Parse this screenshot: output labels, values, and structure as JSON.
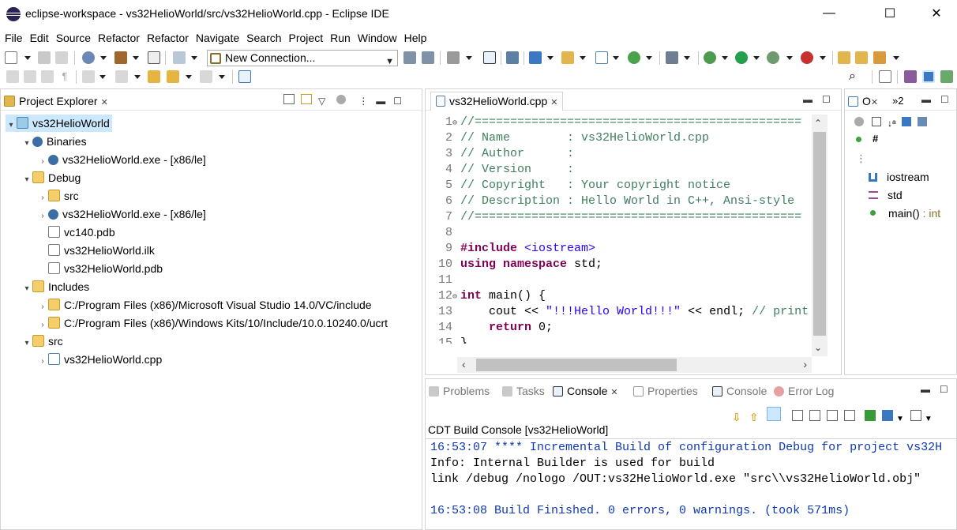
{
  "window": {
    "title": "eclipse-workspace - vs32HelioWorld/src/vs32HelioWorld.cpp - Eclipse IDE",
    "minimize": "—",
    "maximize": "☐",
    "close": "✕"
  },
  "menubar": {
    "items": [
      "File",
      "Edit",
      "Source",
      "Refactor",
      "Refactor",
      "Navigate",
      "Search",
      "Project",
      "Run",
      "Window",
      "Help"
    ]
  },
  "toolbar": {
    "connection_combo": "New Connection..."
  },
  "project_explorer": {
    "tab_label": "Project Explorer",
    "close": "✕",
    "tree": [
      {
        "label": "vs32HelioWorld",
        "icon": "project-icon",
        "twisty": "▾",
        "level": 0,
        "selected": true
      },
      {
        "label": "Binaries",
        "icon": "binaries-icon",
        "twisty": "▾",
        "level": 1
      },
      {
        "label": "vs32HelioWorld.exe - [x86/le]",
        "icon": "executable-icon",
        "twisty": "›",
        "level": 2
      },
      {
        "label": "Debug",
        "icon": "folder-icon",
        "twisty": "▾",
        "level": 1
      },
      {
        "label": "src",
        "icon": "folder-icon",
        "twisty": "›",
        "level": 2
      },
      {
        "label": "vs32HelioWorld.exe - [x86/le]",
        "icon": "executable-icon",
        "twisty": "›",
        "level": 2
      },
      {
        "label": "vc140.pdb",
        "icon": "file-icon",
        "twisty": "",
        "level": 2
      },
      {
        "label": "vs32HelioWorld.ilk",
        "icon": "file-icon",
        "twisty": "",
        "level": 2
      },
      {
        "label": "vs32HelioWorld.pdb",
        "icon": "file-icon",
        "twisty": "",
        "level": 2
      },
      {
        "label": "Includes",
        "icon": "includes-icon",
        "twisty": "▾",
        "level": 1
      },
      {
        "label": "C:/Program Files (x86)/Microsoft Visual Studio 14.0/VC/include",
        "icon": "include-folder-icon",
        "twisty": "›",
        "level": 2
      },
      {
        "label": "C:/Program Files (x86)/Windows Kits/10/Include/10.0.10240.0/ucrt",
        "icon": "include-folder-icon",
        "twisty": "›",
        "level": 2
      },
      {
        "label": "src",
        "icon": "folder-icon",
        "twisty": "▾",
        "level": 1
      },
      {
        "label": "vs32HelioWorld.cpp",
        "icon": "cpp-file-icon",
        "twisty": "›",
        "level": 2
      }
    ]
  },
  "editor": {
    "tab_label": "vs32HelioWorld.cpp",
    "close": "✕",
    "lines": [
      {
        "n": "1",
        "marker": "⊖",
        "parts": [
          {
            "t": "//==============================================",
            "c": "c-com"
          }
        ]
      },
      {
        "n": "2",
        "marker": "",
        "parts": [
          {
            "t": "// Name        : vs32HelioWorld.cpp",
            "c": "c-com"
          }
        ]
      },
      {
        "n": "3",
        "marker": "",
        "parts": [
          {
            "t": "// Author      :",
            "c": "c-com"
          }
        ]
      },
      {
        "n": "4",
        "marker": "",
        "parts": [
          {
            "t": "// Version     :",
            "c": "c-com"
          }
        ]
      },
      {
        "n": "5",
        "marker": "",
        "parts": [
          {
            "t": "// Copyright   : Your copyright notice",
            "c": "c-com"
          }
        ]
      },
      {
        "n": "6",
        "marker": "",
        "parts": [
          {
            "t": "// Description : Hello World in C++, Ansi-style",
            "c": "c-com"
          }
        ]
      },
      {
        "n": "7",
        "marker": "",
        "parts": [
          {
            "t": "//==============================================",
            "c": "c-com"
          }
        ]
      },
      {
        "n": "8",
        "marker": "",
        "parts": [
          {
            "t": "",
            "c": "c-plain"
          }
        ]
      },
      {
        "n": "9",
        "marker": "",
        "parts": [
          {
            "t": "#include ",
            "c": "c-kw"
          },
          {
            "t": "<iostream>",
            "c": "c-inc"
          }
        ]
      },
      {
        "n": "10",
        "marker": "",
        "parts": [
          {
            "t": "using namespace ",
            "c": "c-kw"
          },
          {
            "t": "std;",
            "c": "c-plain"
          }
        ]
      },
      {
        "n": "11",
        "marker": "",
        "parts": [
          {
            "t": "",
            "c": "c-plain"
          }
        ]
      },
      {
        "n": "12",
        "marker": "⊖",
        "parts": [
          {
            "t": "int ",
            "c": "c-kw"
          },
          {
            "t": "main() {",
            "c": "c-plain"
          }
        ]
      },
      {
        "n": "13",
        "marker": "",
        "parts": [
          {
            "t": "    cout << ",
            "c": "c-plain"
          },
          {
            "t": "\"!!!Hello World!!!\"",
            "c": "c-str"
          },
          {
            "t": " << endl; ",
            "c": "c-plain"
          },
          {
            "t": "// print",
            "c": "c-com"
          }
        ]
      },
      {
        "n": "14",
        "marker": "",
        "parts": [
          {
            "t": "    ",
            "c": "c-plain"
          },
          {
            "t": "return ",
            "c": "c-kw"
          },
          {
            "t": "0;",
            "c": "c-plain"
          }
        ]
      },
      {
        "n": "15",
        "marker": "",
        "parts": [
          {
            "t": "}",
            "c": "c-plain"
          }
        ]
      }
    ]
  },
  "outline": {
    "tab_label": "O",
    "other_tab": "»2",
    "items": [
      {
        "label": "iostream",
        "icon": "include-icon",
        "suffix": ""
      },
      {
        "label": "std",
        "icon": "namespace-icon",
        "suffix": ""
      },
      {
        "label": "main()",
        "icon": "function-icon",
        "suffix": " : int"
      }
    ]
  },
  "bottom_panel": {
    "tabs": [
      {
        "label": "Problems",
        "icon": "problems-icon",
        "active": false
      },
      {
        "label": "Tasks",
        "icon": "tasks-icon",
        "active": false
      },
      {
        "label": "Console",
        "icon": "console-icon",
        "active": true
      },
      {
        "label": "Properties",
        "icon": "properties-icon",
        "active": false
      },
      {
        "label": "Console",
        "icon": "console-icon",
        "active": false
      },
      {
        "label": "Error Log",
        "icon": "error-log-icon",
        "active": false
      }
    ],
    "close": "✕",
    "console_title": "CDT Build Console [vs32HelioWorld]",
    "lines": [
      {
        "t": "16:53:07 **** Incremental Build of configuration Debug for project vs32H",
        "c": "con-blue"
      },
      {
        "t": "Info: Internal Builder is used for build",
        "c": "con-black"
      },
      {
        "t": "link /debug /nologo /OUT:vs32HelioWorld.exe \"src\\\\vs32HelioWorld.obj\"",
        "c": "con-black"
      },
      {
        "t": "",
        "c": "con-black"
      },
      {
        "t": "16:53:08 Build Finished. 0 errors, 0 warnings. (took 571ms)",
        "c": "con-blue"
      }
    ]
  },
  "colors": {
    "selection": "#cce8ff",
    "comment": "#3f7f5f",
    "keyword": "#7f0055",
    "string": "#2a00ff",
    "console_info": "#0f38b3"
  }
}
